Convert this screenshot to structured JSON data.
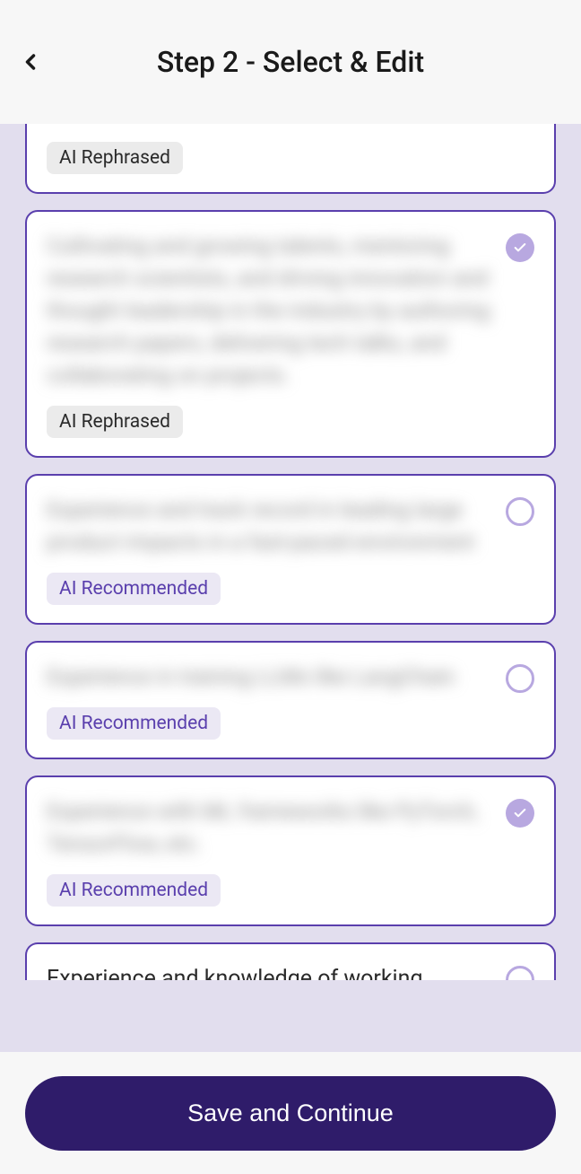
{
  "header": {
    "title": "Step 2 - Select & Edit"
  },
  "cards": [
    {
      "text": "",
      "badge_label": "AI Rephrased",
      "badge_type": "rephrased",
      "checked": null,
      "partial": "top"
    },
    {
      "text": "Cultivating and growing talents, mentoring research scientists, and driving innovation and thought leadership in the industry by authoring research papers, delivering tech talks, and collaborating on projects.",
      "badge_label": "AI Rephrased",
      "badge_type": "rephrased",
      "checked": true,
      "blurred": true
    },
    {
      "text": "Experience and track record in leading large product impacts in a fast-paced environment",
      "badge_label": "AI Recommended",
      "badge_type": "recommended",
      "checked": false,
      "blurred": true
    },
    {
      "text": "Experience in training LLMs like LangChain",
      "badge_label": "AI Recommended",
      "badge_type": "recommended",
      "checked": false,
      "blurred": true
    },
    {
      "text": "Experience with ML frameworks like PyTorch, TensorFlow, etc.",
      "badge_label": "AI Recommended",
      "badge_type": "recommended",
      "checked": true,
      "blurred": true
    },
    {
      "text": "Experience and knowledge of working",
      "badge_label": "",
      "badge_type": "",
      "checked": false,
      "partial": "bottom"
    }
  ],
  "footer": {
    "save_label": "Save and Continue"
  }
}
